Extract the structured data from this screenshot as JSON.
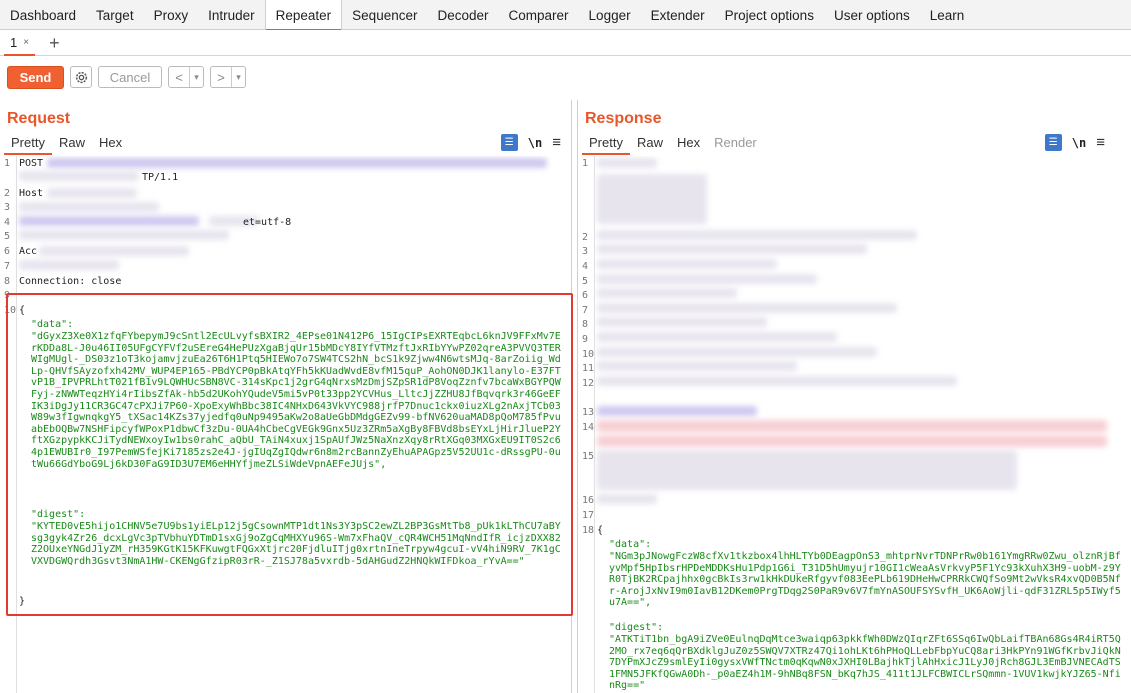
{
  "nav": {
    "tabs": [
      "Dashboard",
      "Target",
      "Proxy",
      "Intruder",
      "Repeater",
      "Sequencer",
      "Decoder",
      "Comparer",
      "Logger",
      "Extender",
      "Project options",
      "User options",
      "Learn"
    ],
    "active_index": 4
  },
  "subtab": {
    "label": "1",
    "close": "×",
    "add": "+"
  },
  "toolbar": {
    "send": "Send",
    "cancel": "Cancel",
    "prev": "<",
    "next": ">",
    "dropdown": "▾"
  },
  "request": {
    "title": "Request",
    "tabs": [
      "Pretty",
      "Raw",
      "Hex"
    ],
    "line1": "POST",
    "line2": "TP/1.1",
    "line3": "Host",
    "line5": "et=utf-8",
    "line6": "Acc",
    "line8": "Connection: close",
    "brace_open": "{",
    "data_key": "\"data\":",
    "data_value": "\"dGyxZ3Xe0X1zfqFYbepymJ9cSntl2EcULvyfsBXIR2_4EPse01N412P6_15IgCIPsEXRTEqbcL6knJV9FFxMv7ErKDDa8L-J0u46II05UFgCYFVf2uSEreG4HePUzXgaBjqUr15bMDcY8IYfVTMzftJxRIbYYwPZ02qreA3PVVQ3TERWIgMUgl-_DS03z1oT3kojamvjzuEa26T6H1Ptq5HIEWo7o7SW4TCS2hN_bcS1k9Zjww4N6wtsMJq-8arZoiig_WdLp-QHVfSAyzofxh42MV_WUP4EP165-PBdYCP0pBkAtqYFh5kKUadWvdE8vfM15quP_AohON0DJK1lanylo-E37FTvP1B_IPVPRLhtT021fB1v9LQWHUcSBN8VC-314sKpc1j2grG4qNrxsMzDmjSZpSR1dP8VoqZznfv7bcaWxBGYPQWFyj-zNWWTeqzHYi4rIibsZfAk-hb5d2UKohYQudeV5mi5vP0t33pp2YCVHus_LltcJjZZHU8JfBqvqrk3r46GeEFIK3iDgJy11CR3GC47cPXJi7P60-XpoExyWhBbc38IC4NHxD643VkVYC988jrfP7Dnuc1ckx0iuzXLg2nAxjTCb03W89w3fIgwnqkgY5_tXSac14KZs37yjedfq0uNp9495aKw2o8aUeGbDMdgGEZv99-bfNV620uaMAD8pQoM785fPvuabEbOQBw7NSHFipcyfWPoxP1dbwCf3zDu-0UA4hCbeCgVEGk9Gnx5Uz3ZRm5aXgBy8FBVd8bsEYxLjHirJlueP2YftXGzpypkKCJiTydNEWxoyIw1bs0rahC_aQbU_TAiN4xuxj1SpAUfJWz5NaXnzXqy8rRtXGq03MXGxEU9IT0S2c64p1EWUBIr0_I97PemWSfejKi7185zs2e4J-jgIUqZgIQdwr6n8m2rcBannZyEhuAPAGpz5V52UU1c-dRssgPU-0utWu66GdYboG9Lj6kD30FaG9ID3U7EM6eHHYfjmeZLSiWdeVpnAEFeJUjs\",",
    "digest_key": "\"digest\":",
    "digest_value": "\"KYTED0vE5hijo1CHNV5e7U9bs1yiELp12j5gCsownMTP1dt1Ns3Y3pSC2ewZL2BP3GsMtTb8_pUk1kLThCU7aBYsg3gyk4Zr26_dcxLgVc3pTVbhuYDTmD1sxGj9oZgCqMHXYu96S-Wm7xFhaQV_cQR4WCH51MqNndIfR_icjzDXX82Z2OUxeYNGdJ1yZM_rH359KGtK15KFKuwgtFQGxXtjrc20FjdluITjg0xrtnIneTrpyw4gcuI-vV4hiN9RV_7K1gCVXVDGWQrdh3Gsvt3NmA1HW-CKENgGfzipR03rR-_Z1SJ78a5vxrdb-5dAHGudZ2HNQkWIFDkoa_rYvA==\"",
    "brace_close": "}"
  },
  "response": {
    "title": "Response",
    "tabs": [
      "Pretty",
      "Raw",
      "Hex",
      "Render"
    ],
    "brace_open": "{",
    "data_key": "\"data\":",
    "data_value": "\"NGm3pJNowgFczW8cfXv1tkzbox4lhHLTYb0DEagpOnS3_mhtprNvrTDNPrRw0b161YmgRRw0Zwu_olznRjBfyvMpf5HpIbsrHPDeMDDKsHu1Pdp1G6i_T31D5hUmyujr10GI1cWeaAsVrkvyP5F1Yc93kXuhX3H9-uobM-z9YR0TjBK2RCpajhhx0gcBkIs3rw1kHkDUkeRfgyvf083EePLb619DHeHwCPRRkCWQfSo9Mt2wVksR4xvQD0B5Nfr-ArojJxNvI9m0IavB12DKem0PrgTDqg2S0PaR9v6V7fmYnASOUFSYSvfH_UK6AoWjli-qdF31ZRL5p5IWyf5u7A==\",",
    "digest_key": "\"digest\":",
    "digest_value": "\"ATKTiT1bn_bgA9iZVe0EulnqDqMtce3waiqp63pkkfWh0DWzQIqrZFt6SSq6IwQbLaifTBAn68Gs4R4iRT5Q2MO_rx7eq6qQrBXdklgJuZ0z5SWQV7XTRz47Qi1ohLKt6hPHoQLLebFbpYuCQ8ari3HkPYn91WGfKrbvJiQkN7DYPmXJcZ9smlEyIi0gysxVWfTNctm0qKqwN0xJXHI0LBajhkTjlAhHxicJ1LyJ0jRch8GJL3EmBJVNECAdTS1FMN5JFKfQGwA0Dh-_p0aEZ4h1M-9hNBq8FSN_bKq7hJS_411t1JLFCBWICLrSQmmn-1VUV1kwjkYJZ65-NfinRg==\"",
    "brace_close": "}"
  }
}
